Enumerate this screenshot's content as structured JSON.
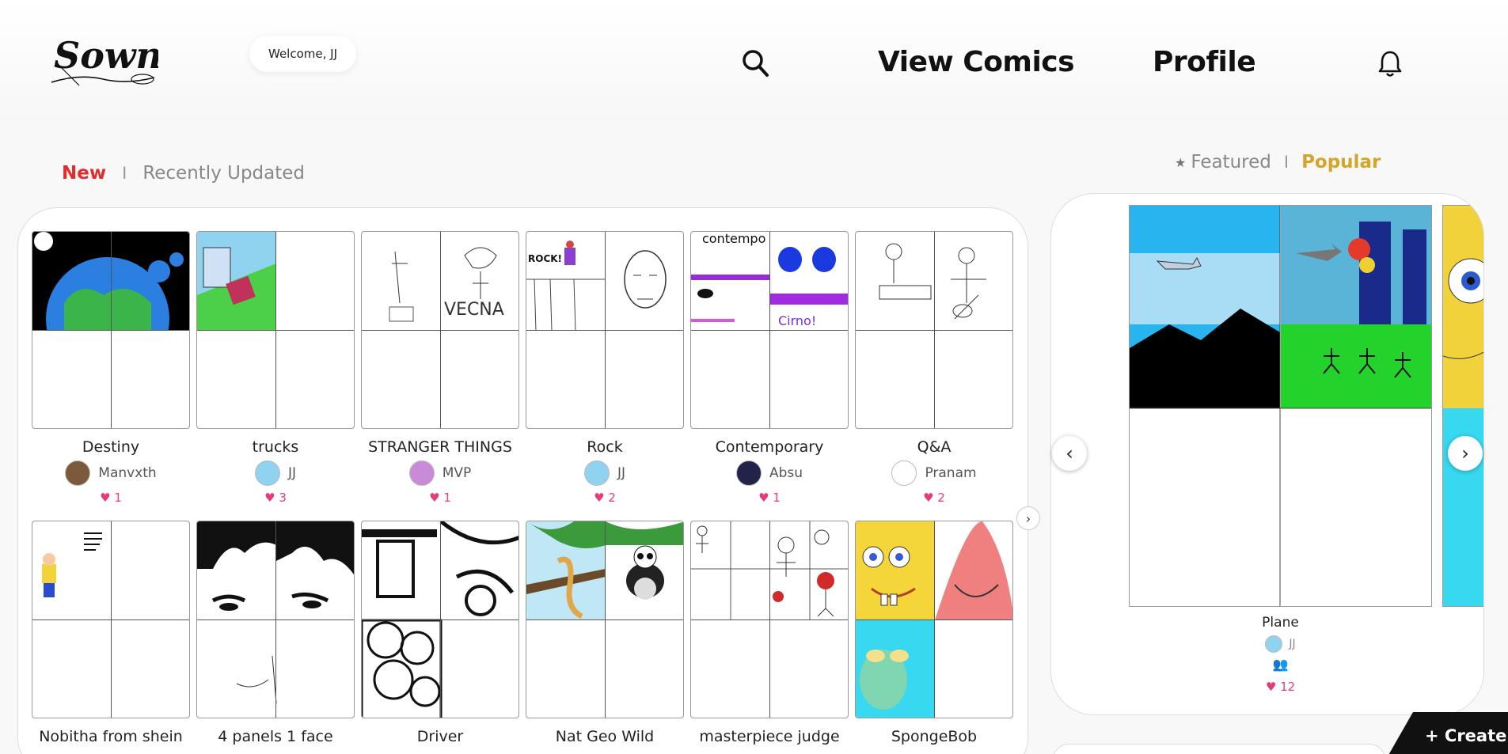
{
  "header": {
    "logo_text": "Sown",
    "welcome": "Welcome, JJ",
    "nav": [
      "View Comics",
      "Profile"
    ]
  },
  "tabs_left": {
    "active": "New",
    "separator": "I",
    "other": "Recently Updated"
  },
  "tabs_right": {
    "star": "★",
    "featured": "Featured",
    "separator": "I",
    "popular": "Popular"
  },
  "comics": [
    {
      "title": "Destiny",
      "author": "Manvxth",
      "likes": "1",
      "avatar_color": "#7a5a3a"
    },
    {
      "title": "trucks",
      "author": "JJ",
      "likes": "3",
      "avatar_color": "#8fd3f0"
    },
    {
      "title": "STRANGER THINGS",
      "author": "MVP",
      "likes": "1",
      "avatar_color": "#c98ad8"
    },
    {
      "title": "Rock",
      "author": "JJ",
      "likes": "2",
      "avatar_color": "#8fd3f0"
    },
    {
      "title": "Contemporary",
      "author": "Absu",
      "likes": "1",
      "avatar_color": "#22224a"
    },
    {
      "title": "Q&A",
      "author": "Pranam",
      "likes": "2",
      "avatar_color": "#ffffff"
    },
    {
      "title": "Nobitha from shein",
      "author": "",
      "likes": "",
      "avatar_color": "#ffffff"
    },
    {
      "title": "4 panels 1 face",
      "author": "",
      "likes": "",
      "avatar_color": "#ffffff"
    },
    {
      "title": "Driver",
      "author": "",
      "likes": "",
      "avatar_color": "#ffffff"
    },
    {
      "title": "Nat Geo Wild",
      "author": "",
      "likes": "",
      "avatar_color": "#ffffff"
    },
    {
      "title": "masterpiece judge",
      "author": "",
      "likes": "",
      "avatar_color": "#ffffff"
    },
    {
      "title": "SpongeBob",
      "author": "",
      "likes": "",
      "avatar_color": "#ffffff"
    }
  ],
  "featured": {
    "title": "Plane",
    "author": "JJ",
    "likes": "12"
  },
  "create_label": "+ Create",
  "icons": {
    "search": "search-icon",
    "bell": "bell-icon",
    "heart": "heart-icon",
    "group": "group-icon"
  }
}
